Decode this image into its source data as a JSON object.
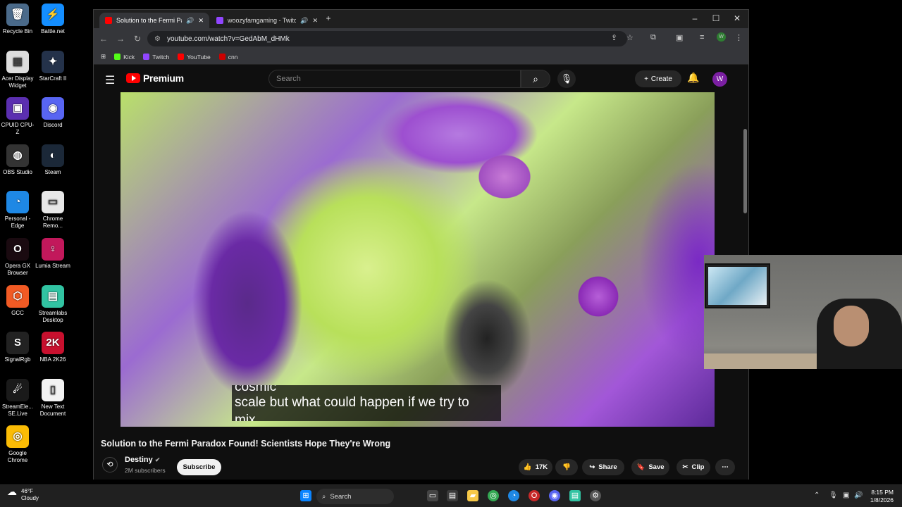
{
  "desktop": {
    "icons": [
      {
        "label": "Recycle Bin",
        "glyph": "🗑",
        "color": "#4a6a8a"
      },
      {
        "label": "Battle.net",
        "glyph": "⚡",
        "color": "#148eff"
      },
      {
        "label": "Acer Display Widget",
        "glyph": "▦",
        "color": "#ddd"
      },
      {
        "label": "StarCraft II",
        "glyph": "✦",
        "color": "#24324a"
      },
      {
        "label": "CPUID CPU-Z",
        "glyph": "▣",
        "color": "#5b2fb0"
      },
      {
        "label": "Discord",
        "glyph": "◉",
        "color": "#5865f2"
      },
      {
        "label": "OBS Studio",
        "glyph": "◍",
        "color": "#333"
      },
      {
        "label": "Steam",
        "glyph": "◐",
        "color": "#1b2838"
      },
      {
        "label": "Personal - Edge",
        "glyph": "◔",
        "color": "#1e88e5"
      },
      {
        "label": "Chrome Remo...",
        "glyph": "▭",
        "color": "#e8e8e8"
      },
      {
        "label": "Opera GX Browser",
        "glyph": "O",
        "color": "#1a0a10"
      },
      {
        "label": "Lumia Stream",
        "glyph": "♀",
        "color": "#c2185b"
      },
      {
        "label": "GCC",
        "glyph": "⬡",
        "color": "#f15a24"
      },
      {
        "label": "Streamlabs Desktop",
        "glyph": "▤",
        "color": "#31c3a2"
      },
      {
        "label": "SignalRgb",
        "glyph": "S",
        "color": "#222"
      },
      {
        "label": "NBA 2K26",
        "glyph": "2K",
        "color": "#c8102e"
      },
      {
        "label": "StreamEle... SE.Live",
        "glyph": "☄",
        "color": "#1a1a1a"
      },
      {
        "label": "New Text Document",
        "glyph": "▯",
        "color": "#f2f2f2"
      },
      {
        "label": "Google Chrome",
        "glyph": "◎",
        "color": "#fbbc05"
      }
    ]
  },
  "browser": {
    "tabs": [
      {
        "title": "Solution to the Fermi Parad",
        "active": true,
        "fav_color": "#ff0000"
      },
      {
        "title": "woozyfamgaming - Twitch",
        "active": false,
        "fav_color": "#9146ff"
      }
    ],
    "new_tab": "+",
    "url": "youtube.com/watch?v=GedAbM_dHMk",
    "bookmarks": [
      {
        "label": "Kick",
        "color": "#53fc18"
      },
      {
        "label": "Twitch",
        "color": "#9146ff"
      },
      {
        "label": "YouTube",
        "color": "#ff0000"
      },
      {
        "label": "cnn",
        "color": "#cc0000"
      }
    ],
    "profile_initial": "W"
  },
  "youtube": {
    "logo_text": "Premium",
    "search_placeholder": "Search",
    "create_label": "Create",
    "avatar_initial": "W",
    "caption_lines": [
      "cosmic",
      "scale but what could happen if we try to",
      "mix"
    ],
    "video_title": "Solution to the Fermi Paradox Found! Scientists Hope They're Wrong",
    "channel_name": "Destiny",
    "subscribers": "2M subscribers",
    "subscribe_label": "Subscribe",
    "likes": "17K",
    "share_label": "Share",
    "save_label": "Save",
    "clip_label": "Clip"
  },
  "taskbar": {
    "temperature": "46°F",
    "condition": "Cloudy",
    "search_label": "Search",
    "time": "8:15 PM",
    "date": "1/8/2026"
  }
}
